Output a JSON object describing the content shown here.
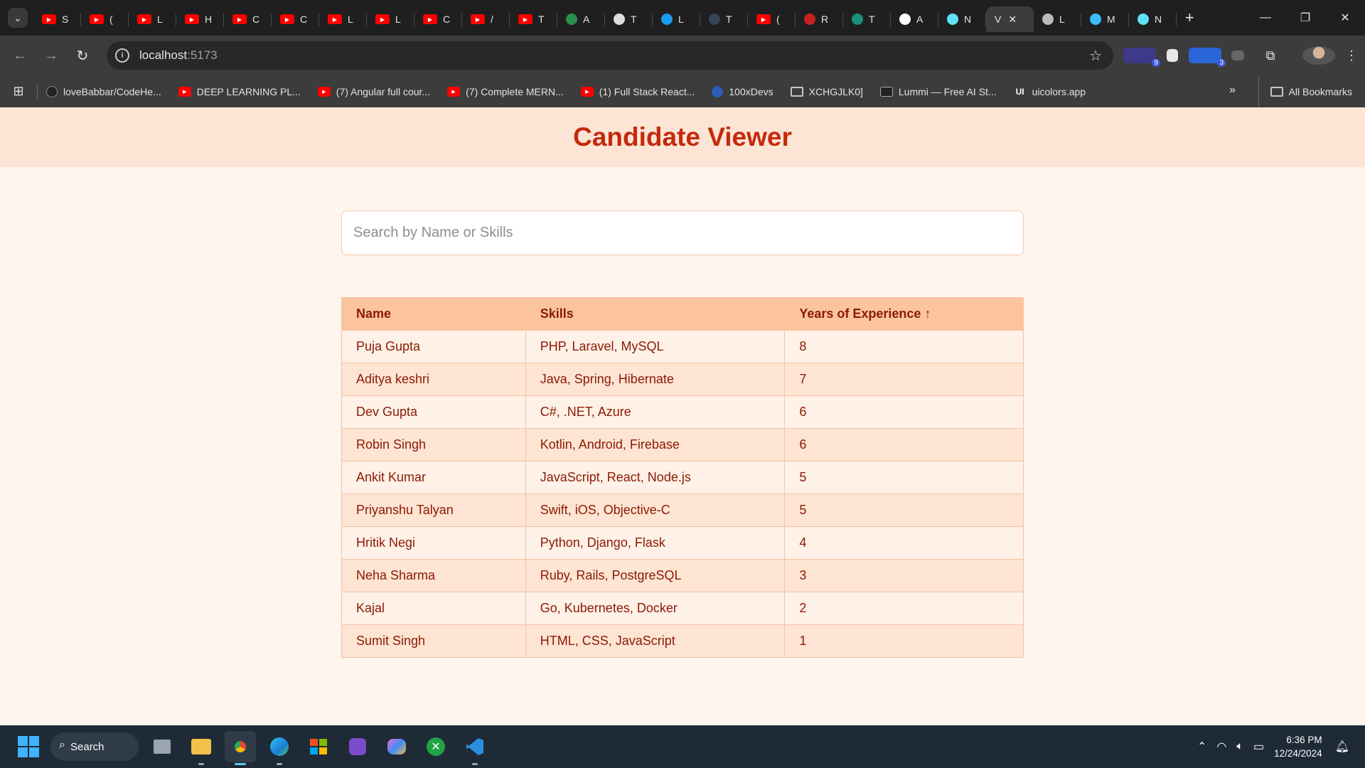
{
  "browser": {
    "tabs": [
      {
        "letter": "S",
        "favicon": "youtube-icon"
      },
      {
        "letter": "(",
        "favicon": "youtube-icon"
      },
      {
        "letter": "L",
        "favicon": "youtube-icon"
      },
      {
        "letter": "H",
        "favicon": "youtube-icon"
      },
      {
        "letter": "C",
        "favicon": "youtube-icon"
      },
      {
        "letter": "C",
        "favicon": "youtube-icon"
      },
      {
        "letter": "L",
        "favicon": "youtube-icon"
      },
      {
        "letter": "L",
        "favicon": "youtube-icon"
      },
      {
        "letter": "C",
        "favicon": "youtube-icon"
      },
      {
        "letter": "/",
        "favicon": "youtube-icon"
      },
      {
        "letter": "T",
        "favicon": "youtube-icon"
      },
      {
        "letter": "A",
        "favicon": "gemini-icon"
      },
      {
        "letter": "T",
        "favicon": "doc-icon"
      },
      {
        "letter": "L",
        "favicon": "t-icon"
      },
      {
        "letter": "T",
        "favicon": "profile-icon"
      },
      {
        "letter": "(",
        "favicon": "youtube-icon"
      },
      {
        "letter": "R",
        "favicon": "gmail-icon"
      },
      {
        "letter": "T",
        "favicon": "sheets-icon"
      },
      {
        "letter": "A",
        "favicon": "notion-icon"
      },
      {
        "letter": "N",
        "favicon": "react-icon"
      },
      {
        "letter": "V",
        "favicon": "vite-icon",
        "active": true
      },
      {
        "letter": "L",
        "favicon": "openai-icon"
      },
      {
        "letter": "M",
        "favicon": "tailwind-icon"
      },
      {
        "letter": "N",
        "favicon": "react-icon"
      }
    ],
    "url_host": "localhost",
    "url_port": ":5173",
    "bookmarks": [
      {
        "label": "loveBabbar/CodeHe...",
        "icon": "github-icon"
      },
      {
        "label": "DEEP LEARNING PL...",
        "icon": "youtube-icon"
      },
      {
        "label": "(7) Angular full cour...",
        "icon": "youtube-icon"
      },
      {
        "label": "(7) Complete MERN...",
        "icon": "youtube-icon"
      },
      {
        "label": "(1) Full Stack React...",
        "icon": "youtube-icon"
      },
      {
        "label": "100xDevs",
        "icon": "profile-icon"
      },
      {
        "label": "XCHGJLK0]",
        "icon": "folder-icon"
      },
      {
        "label": "Lummi — Free AI St...",
        "icon": "lummi-icon"
      },
      {
        "label": "uicolors.app",
        "icon": "ui-icon"
      }
    ],
    "all_bookmarks_label": "All Bookmarks",
    "extension_badges": {
      "first": "9",
      "second": "3"
    }
  },
  "app": {
    "title": "Candidate Viewer",
    "search_placeholder": "Search by Name or Skills",
    "search_value": "",
    "columns": {
      "name": "Name",
      "skills": "Skills",
      "experience": "Years of Experience ↑"
    },
    "candidates": [
      {
        "name": "Puja Gupta",
        "skills": "PHP, Laravel, MySQL",
        "years": "8"
      },
      {
        "name": "Aditya keshri",
        "skills": "Java, Spring, Hibernate",
        "years": "7"
      },
      {
        "name": "Dev Gupta",
        "skills": "C#, .NET, Azure",
        "years": "6"
      },
      {
        "name": "Robin Singh",
        "skills": "Kotlin, Android, Firebase",
        "years": "6"
      },
      {
        "name": "Ankit Kumar",
        "skills": "JavaScript, React, Node.js",
        "years": "5"
      },
      {
        "name": "Priyanshu Talyan",
        "skills": "Swift, iOS, Objective-C",
        "years": "5"
      },
      {
        "name": "Hritik Negi",
        "skills": "Python, Django, Flask",
        "years": "4"
      },
      {
        "name": "Neha Sharma",
        "skills": "Ruby, Rails, PostgreSQL",
        "years": "3"
      },
      {
        "name": "Kajal",
        "skills": "Go, Kubernetes, Docker",
        "years": "2"
      },
      {
        "name": "Sumit Singh",
        "skills": "HTML, CSS, JavaScript",
        "years": "1"
      }
    ],
    "colors": {
      "title": "#c42a0b",
      "header_bg": "#fde5d5",
      "table_header_bg": "#fcc49d",
      "text": "#8b1a04"
    }
  },
  "taskbar": {
    "search_label": "Search",
    "time": "6:36 PM",
    "date": "12/24/2024"
  }
}
